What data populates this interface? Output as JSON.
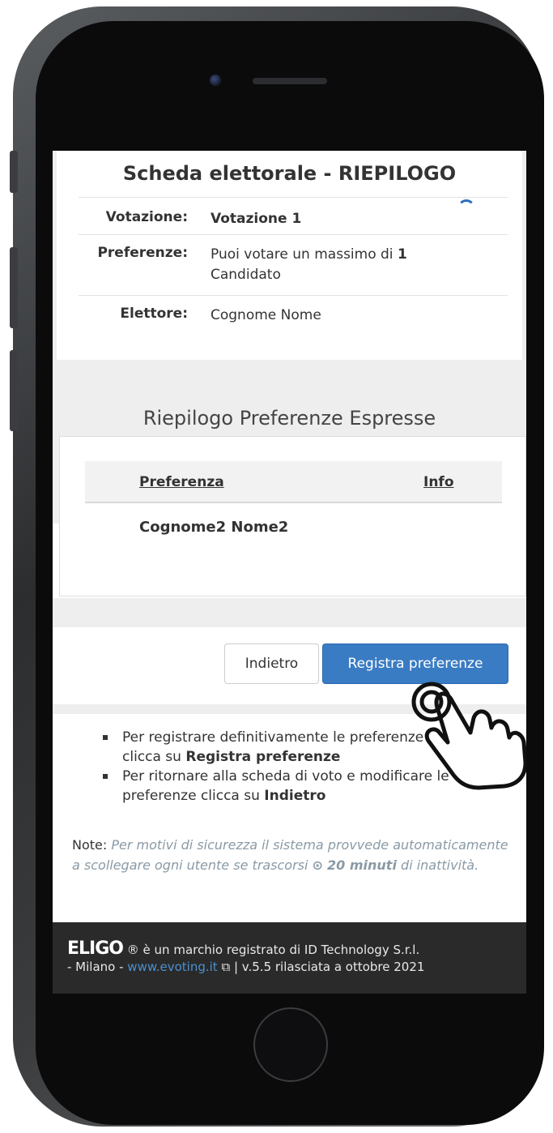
{
  "ballot": {
    "title": "Scheda elettorale - RIEPILOGO",
    "rows": [
      {
        "label": "Votazione:",
        "value": "Votazione 1"
      },
      {
        "label": "Preferenze:",
        "value_prefix": "Puoi votare un massimo di",
        "value_bold": "1",
        "value_suffix": "Candidato"
      },
      {
        "label": "Elettore:",
        "value": "Cognome Nome"
      }
    ]
  },
  "summary": {
    "title": "Riepilogo Preferenze Espresse",
    "columns": [
      "Preferenza",
      "Info"
    ],
    "rows": [
      {
        "preferenza": "Cognome2 Nome2",
        "info": ""
      }
    ]
  },
  "actions": {
    "back_label": "Indietro",
    "register_label": "Registra preferenze"
  },
  "instructions": [
    {
      "text": "Per registrare definitivamente le preferenze di voto clicca su",
      "bold": "Registra preferenze"
    },
    {
      "text": "Per ritornare alla scheda di voto e modificare le preferenze clicca su",
      "bold": "Indietro"
    }
  ],
  "note": {
    "label": "Note:",
    "text": "Per motivi di sicurezza il sistema provvede automaticamente a scollegare ogni utente se trascorsi",
    "duration": "20 minuti",
    "suffix": "di inattività."
  },
  "footer": {
    "logo": "ELIGO",
    "line1": "® è un marchio registrato di ID Technology S.r.l.",
    "line2_prefix": "- Milano -",
    "link": "www.evoting.it",
    "line2_suffix": "| v.5.5 rilasciata a ottobre 2021"
  },
  "colors": {
    "primary": "#3a7cc3",
    "footer_bg": "#2a2a2a",
    "note_text": "#8a9aa5"
  }
}
